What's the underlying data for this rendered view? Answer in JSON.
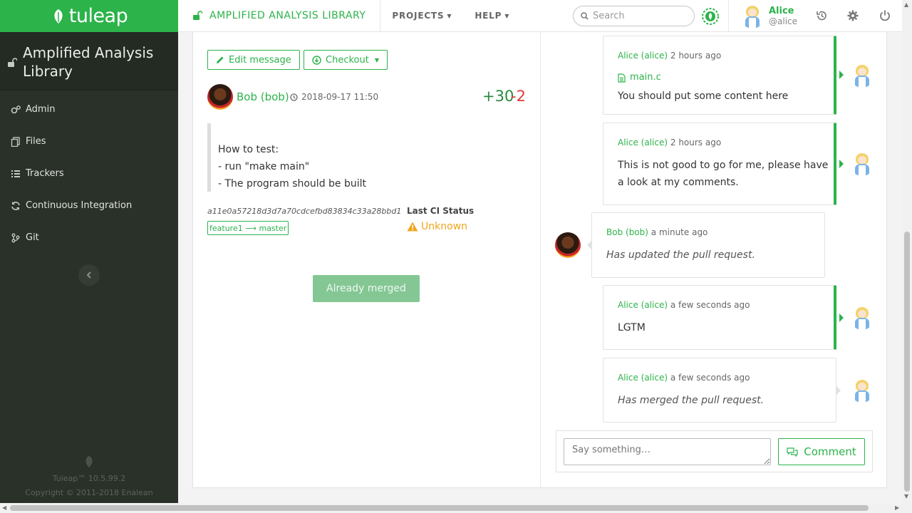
{
  "brand": {
    "logo_text": "tuleap"
  },
  "project": {
    "name": "Amplified Analysis Library"
  },
  "sidebar": {
    "items": [
      {
        "label": "Admin",
        "icon": "gears-icon"
      },
      {
        "label": "Files",
        "icon": "files-icon"
      },
      {
        "label": "Trackers",
        "icon": "list-icon"
      },
      {
        "label": "Continuous Integration",
        "icon": "refresh-icon"
      },
      {
        "label": "Git",
        "icon": "git-icon"
      }
    ],
    "version": "Tuleap™ 10.5.99.2",
    "copyright": "Copyright © 2011-2018 Enalean"
  },
  "topbar": {
    "breadcrumb": "AMPLIFIED ANALYSIS LIBRARY",
    "menu_projects": "PROJECTS",
    "menu_help": "HELP",
    "search_placeholder": "Search",
    "user_name": "Alice",
    "user_login": "@alice"
  },
  "pull_request": {
    "edit_label": "Edit message",
    "checkout_label": "Checkout",
    "author": "Bob (bob)",
    "date": "2018-09-17 11:50",
    "additions": "+30",
    "deletions": "-2",
    "description": [
      "How to test:",
      "- run \"make main\"",
      "- The program should be built"
    ],
    "sha": "a11e0a57218d3d7a70cdcefbd83834c33a28bbd1",
    "branch": "feature1 ⟶ master",
    "ci_title": "Last CI Status",
    "ci_status": "Unknown",
    "merged_label": "Already merged"
  },
  "comments": [
    {
      "author": "Alice (alice)",
      "time": "2 hours ago",
      "file": "main.c",
      "text": "You should put some content here"
    },
    {
      "author": "Alice (alice)",
      "time": "2 hours ago",
      "text_line1": "This is not good to go for me, please have",
      "text_line2": "a look at my comments."
    },
    {
      "author": "Bob (bob)",
      "time": "a minute ago",
      "text": "Has updated the pull request."
    },
    {
      "author": "Alice (alice)",
      "time": "a few seconds ago",
      "text": "LGTM"
    },
    {
      "author": "Alice (alice)",
      "time": "a few seconds ago",
      "text": "Has merged the pull request."
    }
  ],
  "reply": {
    "placeholder": "Say something…",
    "button": "Comment"
  },
  "colors": {
    "accent": "#2cb34a",
    "sidebar": "#2a3129",
    "additions": "#2a8a3e",
    "deletions": "#e03a3a",
    "warning": "#f0a51c"
  }
}
